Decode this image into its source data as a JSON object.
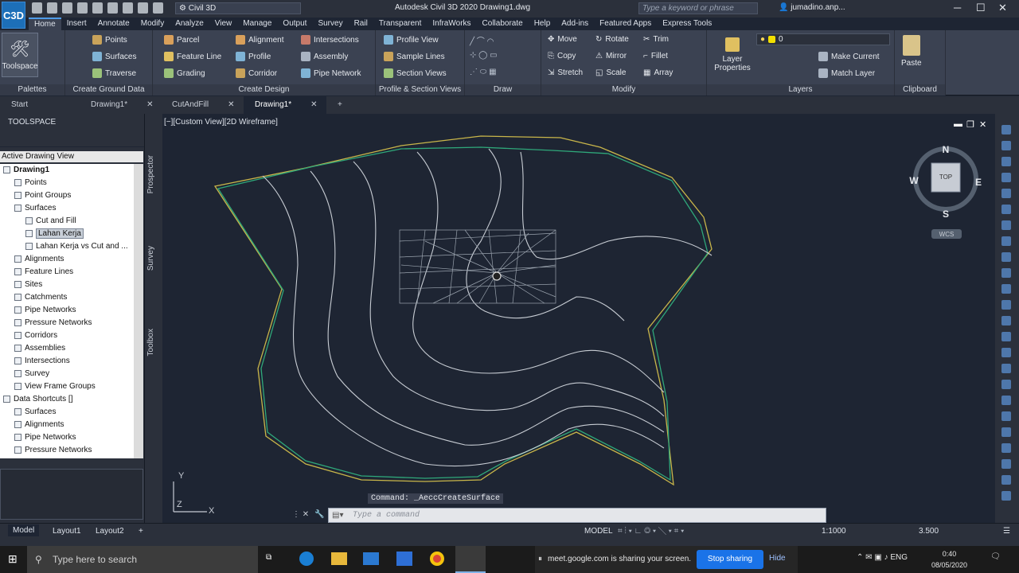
{
  "app": {
    "logo": "C3D",
    "title": "Autodesk Civil 3D 2020   Drawing1.dwg",
    "workspace": "Civil 3D",
    "search_placeholder": "Type a keyword or phrase",
    "user": "jumadino.anp..."
  },
  "menu": [
    "Home",
    "Insert",
    "Annotate",
    "Modify",
    "Analyze",
    "View",
    "Manage",
    "Output",
    "Survey",
    "Rail",
    "Transparent",
    "InfraWorks",
    "Collaborate",
    "Help",
    "Add-ins",
    "Featured Apps",
    "Express Tools"
  ],
  "ribbon": {
    "palettes": {
      "title": "Palettes",
      "toolspace": "Toolspace"
    },
    "ground": {
      "title": "Create Ground Data",
      "points": "Points",
      "surfaces": "Surfaces",
      "traverse": "Traverse"
    },
    "design": {
      "title": "Create Design",
      "parcel": "Parcel",
      "feature_line": "Feature Line",
      "grading": "Grading",
      "alignment": "Alignment",
      "profile": "Profile",
      "corridor": "Corridor",
      "intersections": "Intersections",
      "assembly": "Assembly",
      "pipe_network": "Pipe Network"
    },
    "profile": {
      "title": "Profile & Section Views",
      "profile_view": "Profile View",
      "sample_lines": "Sample Lines",
      "section_views": "Section Views"
    },
    "draw": {
      "title": "Draw"
    },
    "modify": {
      "title": "Modify",
      "move": "Move",
      "rotate": "Rotate",
      "trim": "Trim",
      "copy": "Copy",
      "mirror": "Mirror",
      "fillet": "Fillet",
      "stretch": "Stretch",
      "scale": "Scale",
      "array": "Array"
    },
    "layers": {
      "title": "Layers",
      "layer_properties": "Layer Properties",
      "current_layer": "0",
      "make_current": "Make Current",
      "match_layer": "Match Layer"
    },
    "clipboard": {
      "title": "Clipboard",
      "paste": "Paste"
    }
  },
  "doc_tabs": [
    "Start",
    "Drawing1*",
    "CutAndFill",
    "Drawing1*"
  ],
  "toolspace": {
    "title": "TOOLSPACE",
    "view": "Active Drawing View",
    "tree": [
      {
        "label": "Drawing1",
        "level": 0,
        "bold": true
      },
      {
        "label": "Points",
        "level": 1
      },
      {
        "label": "Point Groups",
        "level": 1
      },
      {
        "label": "Surfaces",
        "level": 1
      },
      {
        "label": "Cut and Fill",
        "level": 2
      },
      {
        "label": "Lahan Kerja",
        "level": 2,
        "selected": true
      },
      {
        "label": "Lahan Kerja vs Cut and ...",
        "level": 2
      },
      {
        "label": "Alignments",
        "level": 1
      },
      {
        "label": "Feature Lines",
        "level": 1
      },
      {
        "label": "Sites",
        "level": 1
      },
      {
        "label": "Catchments",
        "level": 1
      },
      {
        "label": "Pipe Networks",
        "level": 1
      },
      {
        "label": "Pressure Networks",
        "level": 1
      },
      {
        "label": "Corridors",
        "level": 1
      },
      {
        "label": "Assemblies",
        "level": 1
      },
      {
        "label": "Intersections",
        "level": 1
      },
      {
        "label": "Survey",
        "level": 1
      },
      {
        "label": "View Frame Groups",
        "level": 1
      },
      {
        "label": "Data Shortcuts []",
        "level": 0
      },
      {
        "label": "Surfaces",
        "level": 1
      },
      {
        "label": "Alignments",
        "level": 1
      },
      {
        "label": "Pipe Networks",
        "level": 1
      },
      {
        "label": "Pressure Networks",
        "level": 1
      }
    ],
    "side_tabs": [
      "Prospector",
      "Survey",
      "Toolbox"
    ]
  },
  "viewport": {
    "label": "[−][Custom View][2D Wireframe]",
    "compass": {
      "n": "N",
      "s": "S",
      "e": "E",
      "w": "W",
      "top": "TOP",
      "wcs": "WCS"
    },
    "ucs": {
      "x": "X",
      "y": "Y",
      "z": "Z"
    }
  },
  "command": {
    "history": "Command: _AeccCreateSurface",
    "placeholder": "Type a command"
  },
  "status": {
    "tabs": [
      "Model",
      "Layout1",
      "Layout2"
    ],
    "mode": "MODEL",
    "scale": "1:1000",
    "elevation": "3.500"
  },
  "taskbar": {
    "search": "Type here to search",
    "sharing": "meet.google.com is sharing your screen.",
    "stop": "Stop sharing",
    "hide": "Hide",
    "time": "0:40",
    "date": "08/05/2020"
  }
}
